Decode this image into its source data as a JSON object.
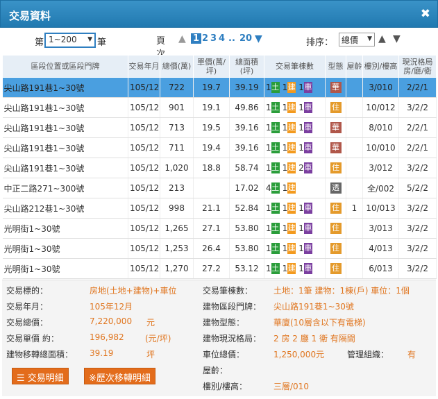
{
  "window": {
    "title": "交易資料"
  },
  "controls": {
    "per_page_prefix": "第",
    "per_page_value": "1~200",
    "per_page_suffix": "筆",
    "page_label": "頁次",
    "pages": [
      "1",
      "2",
      "3",
      "4"
    ],
    "page_ellipsis": "..",
    "page_last": "20",
    "sort_label": "排序：",
    "sort_value": "總價"
  },
  "table": {
    "headers": [
      "區段位置或區段門牌",
      "交易年月",
      "總價(萬)",
      "單價(萬/坪)",
      "總面積(坪)",
      "交易筆棟數",
      "型態",
      "屋齡",
      "樓別/樓高",
      "現況格局房/廳/衛"
    ],
    "rows": [
      {
        "addr": "尖山路191巷1~30號",
        "ym": "105/12",
        "total": "722",
        "unit": "19.7",
        "area": "39.19",
        "land": "1",
        "land_t": "土",
        "bld": "1",
        "bld_t": "建",
        "car": "1",
        "car_t": "車",
        "type": "華",
        "age": "",
        "floor": "3/010",
        "layout": "2/2/1"
      },
      {
        "addr": "尖山路191巷1~30號",
        "ym": "105/12",
        "total": "901",
        "unit": "19.1",
        "area": "49.86",
        "land": "1",
        "land_t": "土",
        "bld": "1",
        "bld_t": "建",
        "car": "1",
        "car_t": "車",
        "type": "住",
        "age": "",
        "floor": "10/012",
        "layout": "3/2/2"
      },
      {
        "addr": "尖山路191巷1~30號",
        "ym": "105/12",
        "total": "713",
        "unit": "19.5",
        "area": "39.16",
        "land": "1",
        "land_t": "土",
        "bld": "1",
        "bld_t": "建",
        "car": "1",
        "car_t": "車",
        "type": "華",
        "age": "",
        "floor": "8/010",
        "layout": "2/2/1"
      },
      {
        "addr": "尖山路191巷1~30號",
        "ym": "105/12",
        "total": "711",
        "unit": "19.4",
        "area": "39.16",
        "land": "1",
        "land_t": "土",
        "bld": "1",
        "bld_t": "建",
        "car": "1",
        "car_t": "車",
        "type": "華",
        "age": "",
        "floor": "10/010",
        "layout": "2/2/1"
      },
      {
        "addr": "尖山路191巷1~30號",
        "ym": "105/12",
        "total": "1,020",
        "unit": "18.8",
        "area": "58.74",
        "land": "1",
        "land_t": "土",
        "bld": "1",
        "bld_t": "建",
        "car": "2",
        "car_t": "車",
        "type": "住",
        "age": "",
        "floor": "3/012",
        "layout": "3/2/2"
      },
      {
        "addr": "中正二路271~300號",
        "ym": "105/12",
        "total": "213",
        "unit": "",
        "area": "17.02",
        "land": "4",
        "land_t": "土",
        "bld": "1",
        "bld_t": "建",
        "car": "",
        "car_t": "",
        "type": "透",
        "age": "",
        "floor": "全/002",
        "layout": "5/2/2"
      },
      {
        "addr": "尖山路212巷1~30號",
        "ym": "105/12",
        "total": "998",
        "unit": "21.1",
        "area": "52.84",
        "land": "1",
        "land_t": "土",
        "bld": "1",
        "bld_t": "建",
        "car": "1",
        "car_t": "車",
        "type": "住",
        "age": "1",
        "floor": "10/013",
        "layout": "3/2/2"
      },
      {
        "addr": "光明街1~30號",
        "ym": "105/12",
        "total": "1,265",
        "unit": "27.1",
        "area": "53.80",
        "land": "1",
        "land_t": "土",
        "bld": "1",
        "bld_t": "建",
        "car": "1",
        "car_t": "車",
        "type": "住",
        "age": "",
        "floor": "3/013",
        "layout": "3/2/2"
      },
      {
        "addr": "光明街1~30號",
        "ym": "105/12",
        "total": "1,253",
        "unit": "26.4",
        "area": "53.80",
        "land": "1",
        "land_t": "土",
        "bld": "1",
        "bld_t": "建",
        "car": "1",
        "car_t": "車",
        "type": "住",
        "age": "",
        "floor": "4/013",
        "layout": "3/2/2"
      },
      {
        "addr": "光明街1~30號",
        "ym": "105/12",
        "total": "1,270",
        "unit": "27.2",
        "area": "53.12",
        "land": "1",
        "land_t": "土",
        "bld": "1",
        "bld_t": "建",
        "car": "1",
        "car_t": "車",
        "type": "住",
        "age": "",
        "floor": "6/013",
        "layout": "3/2/2"
      }
    ]
  },
  "detail": {
    "target_label": "交易標的：",
    "target_value": "房地(土地+建物)+車位",
    "ym_label": "交易年月：",
    "ym_value": "105年12月",
    "total_label": "交易總價：",
    "total_value": "7,220,000",
    "total_unit": "元",
    "unit_label": "交易單價 約：",
    "unit_value": "196,982",
    "unit_unit": "(元/坪)",
    "area_label": "建物移轉總面積：",
    "area_value": "39.19",
    "area_unit": "坪",
    "count_label": "交易筆棟數：",
    "count_value": "土地：1筆 建物：1棟(戶) 車位：1個",
    "addr_label": "建物區段門牌：",
    "addr_value": "尖山路191巷1~30號",
    "btype_label": "建物型態：",
    "btype_value": "華廈(10層含以下有電梯)",
    "layout_label": "建物現況格局：",
    "layout_value": "2 房 2 廳 1 衛 有隔間",
    "park_label": "車位總價：",
    "park_value": "1,250,000元",
    "mgmt_label": "管理組織：",
    "mgmt_value": "有",
    "age_label": "屋齡：",
    "floor_label": "樓別/樓高：",
    "floor_value": "三層/010",
    "btn_detail": "交易明細",
    "btn_history": "※歷次移轉明細"
  }
}
